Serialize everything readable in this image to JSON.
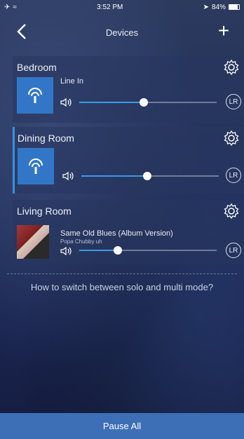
{
  "status_bar": {
    "time": "3:52 PM",
    "battery": "84%"
  },
  "nav": {
    "title": "Devices",
    "add_label": "+"
  },
  "rooms": [
    {
      "name": "Bedroom",
      "source": "Line In",
      "volume": 0.47,
      "channel_label": "LR"
    },
    {
      "name": "Dining Room",
      "source": "",
      "volume": 0.48,
      "channel_label": "LR"
    },
    {
      "name": "Living Room",
      "track": "Same Old Blues (Album Version)",
      "artist": "Popa Chubby  uh",
      "volume": 0.28,
      "channel_label": "LR"
    }
  ],
  "help_text": "How to switch between solo and multi mode?",
  "footer": {
    "pause_all": "Pause All"
  },
  "colors": {
    "accent": "#3b9ae8",
    "thumb": "#3277c7",
    "footer": "#3d6fb6"
  },
  "icons": {
    "back": "chevron-left-icon",
    "add": "plus-icon",
    "settings": "gear-icon",
    "speaker": "speaker-icon",
    "device": "wifi-speaker-icon"
  }
}
